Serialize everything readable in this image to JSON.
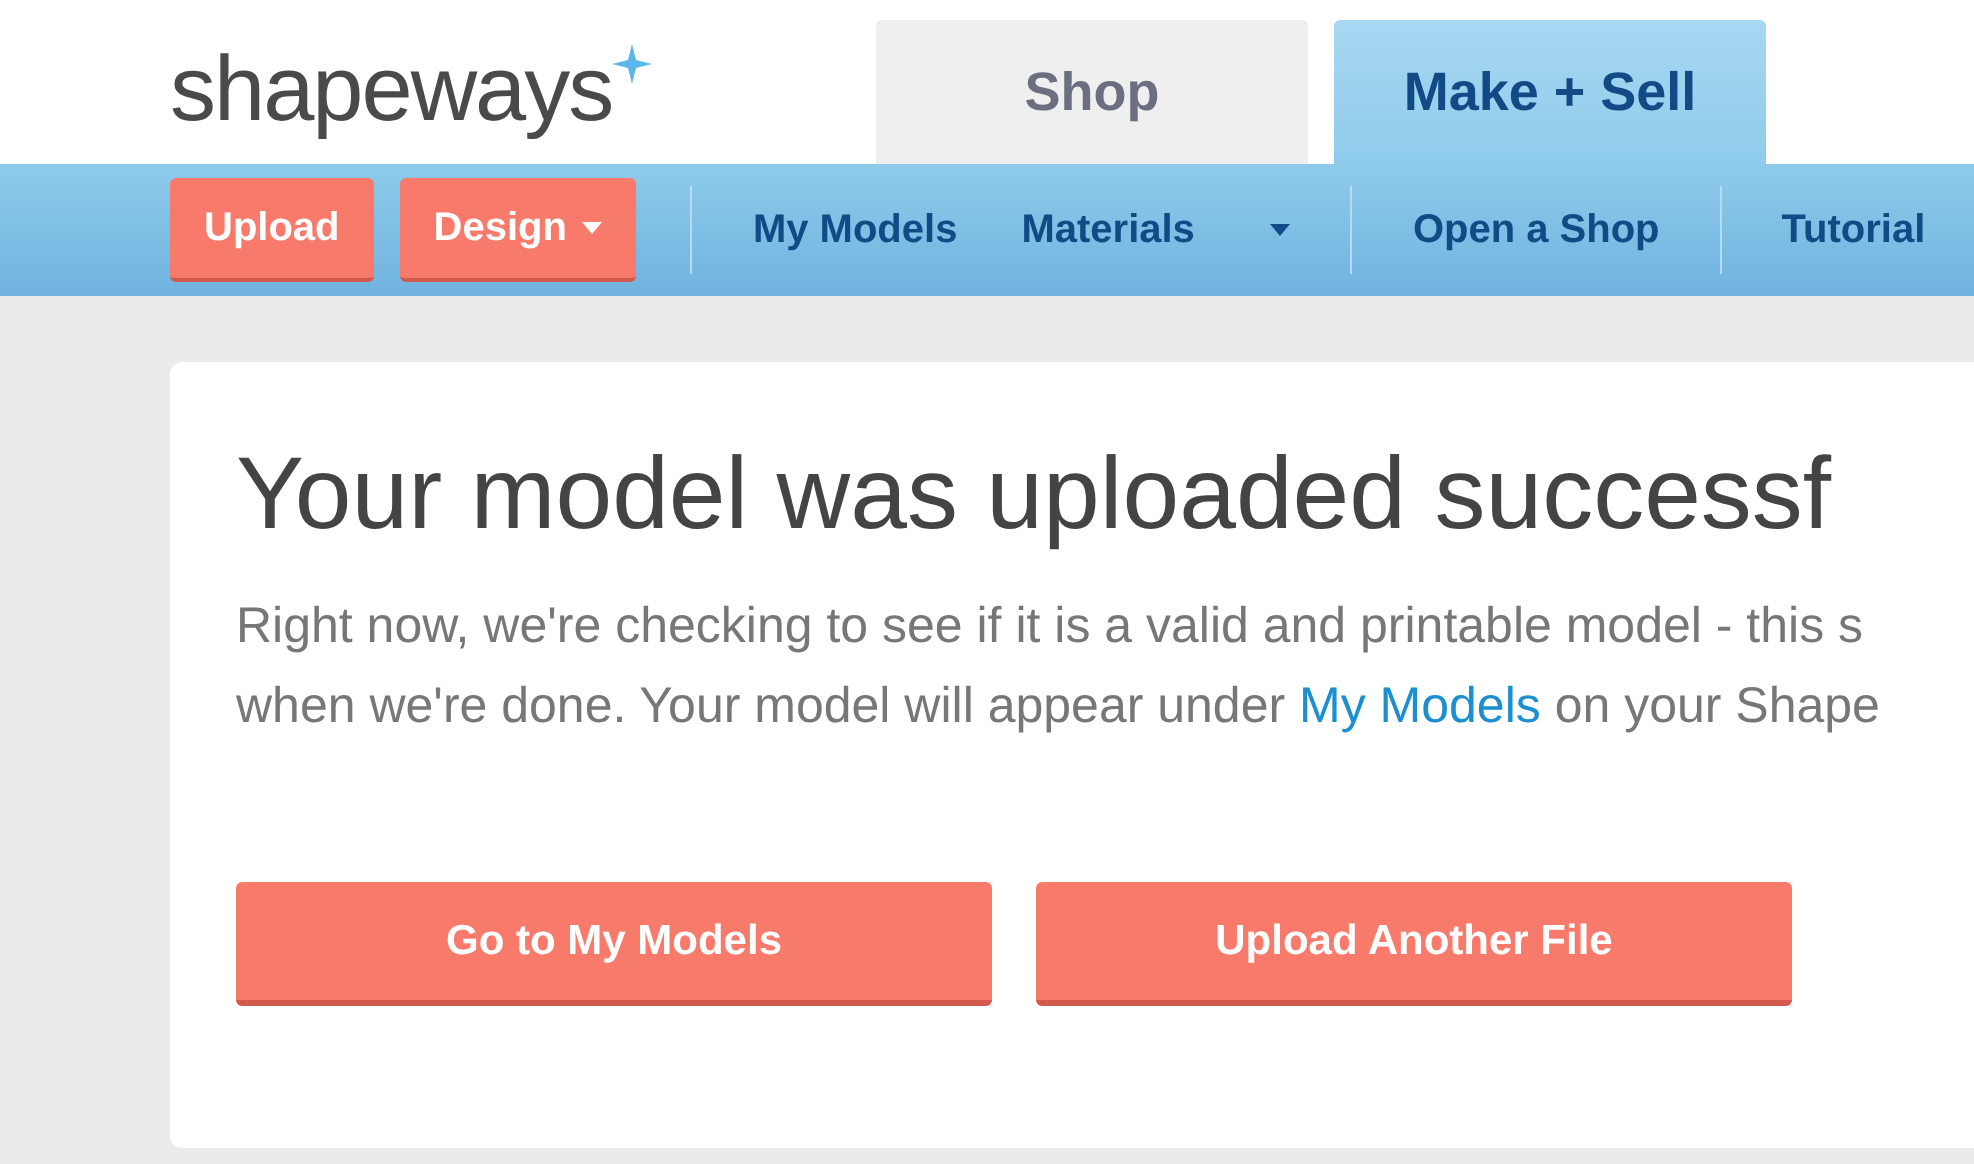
{
  "logo": {
    "text": "shapeways"
  },
  "top_tabs": [
    {
      "label": "Shop",
      "selected": false
    },
    {
      "label": "Make + Sell",
      "selected": true
    }
  ],
  "nav": [
    {
      "kind": "button",
      "label": "Upload",
      "caret": false
    },
    {
      "kind": "button",
      "label": "Design",
      "caret": true
    },
    {
      "kind": "divider"
    },
    {
      "kind": "link",
      "label": "My Models",
      "caret": false
    },
    {
      "kind": "link",
      "label": "Materials",
      "caret": true
    },
    {
      "kind": "divider"
    },
    {
      "kind": "link",
      "label": "Open a Shop",
      "caret": false
    },
    {
      "kind": "divider"
    },
    {
      "kind": "link",
      "label": "Tutorial",
      "caret": false
    }
  ],
  "card": {
    "heading": "Your model was uploaded successf",
    "lines": [
      {
        "text": "Right now, we're checking to see if it is a valid and printable model - this s"
      },
      {
        "before": "when we're done. Your model will appear under ",
        "link": "My Models",
        "after": " on your Shape"
      }
    ],
    "buttons": [
      "Go to My Models",
      "Upload Another File"
    ]
  }
}
